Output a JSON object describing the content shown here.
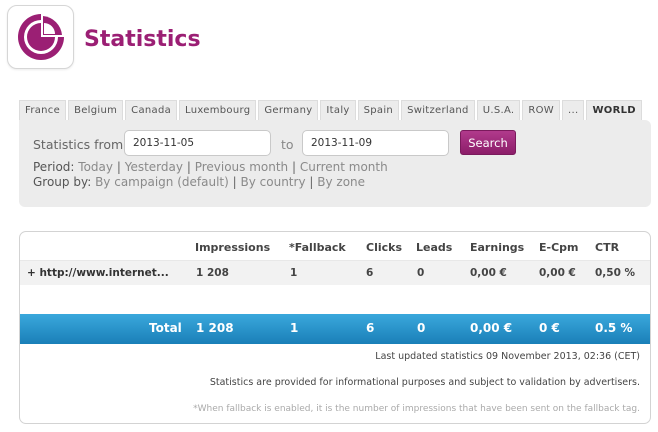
{
  "header": {
    "title": "Statistics",
    "logo_icon": "pie-chart-icon",
    "brand_color": "#9b1f74"
  },
  "tabs": [
    {
      "label": "France",
      "active": false
    },
    {
      "label": "Belgium",
      "active": false
    },
    {
      "label": "Canada",
      "active": false
    },
    {
      "label": "Luxembourg",
      "active": false
    },
    {
      "label": "Germany",
      "active": false
    },
    {
      "label": "Italy",
      "active": false
    },
    {
      "label": "Spain",
      "active": false
    },
    {
      "label": "Switzerland",
      "active": false
    },
    {
      "label": "U.S.A.",
      "active": false
    },
    {
      "label": "ROW",
      "active": false
    },
    {
      "label": "...",
      "active": false
    },
    {
      "label": "WORLD",
      "active": true
    }
  ],
  "filters": {
    "from_label": "Statistics from",
    "from_value": "2013-11-05",
    "to_label": "to",
    "to_value": "2013-11-09",
    "search_label": "Search",
    "period_label": "Period:",
    "period_links": [
      "Today",
      "Yesterday",
      "Previous month",
      "Current month"
    ],
    "group_label": "Group by:",
    "group_links": [
      "By campaign (default)",
      "By country",
      "By zone"
    ]
  },
  "table": {
    "headers": [
      "Impressions",
      "*Fallback",
      "Clicks",
      "Leads",
      "Earnings",
      "E-Cpm",
      "CTR"
    ],
    "rows": [
      {
        "name": "+ http://www.internet...",
        "impressions": "1 208",
        "fallback": "1",
        "clicks": "6",
        "leads": "0",
        "earnings": "0,00 €",
        "ecpm": "0,00 €",
        "ctr": "0,50 %"
      }
    ],
    "total": {
      "label": "Total",
      "impressions": "1 208",
      "fallback": "1",
      "clicks": "6",
      "leads": "0",
      "earnings": "0,00 €",
      "ecpm": "0 €",
      "ctr": "0.5 %"
    }
  },
  "notes": {
    "last_updated": "Last updated statistics 09 November 2013, 02:36 (CET)",
    "disclaimer": "Statistics are provided for informational purposes and subject to validation by advertisers.",
    "fallback_note": "*When fallback is enabled, it is the number of impressions that have been sent on the fallback tag."
  }
}
